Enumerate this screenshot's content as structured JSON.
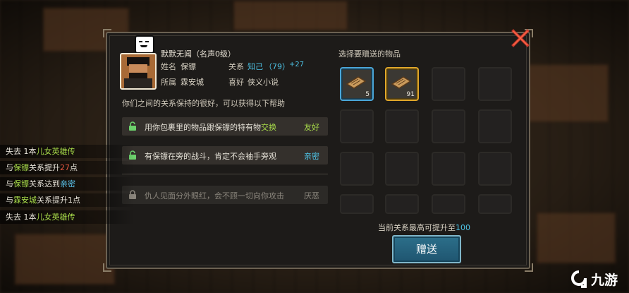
{
  "character": {
    "name": "默默无闻（名声0级）",
    "name_label": "姓名",
    "name_value": "保镖",
    "relation_label": "关系",
    "relation_value": "知己",
    "relation_score": "（79）",
    "relation_delta": "+27",
    "faction_label": "所属",
    "faction_value": "霖安城",
    "hobby_label": "喜好",
    "hobby_value": "侠义小说"
  },
  "relation_desc": "你们之间的关系保持的很好，可以获得以下帮助",
  "perks": [
    {
      "text_a": "用你包裹里的物品跟保镖的特有物",
      "text_b": "交换",
      "tag": "友好",
      "unlocked": true
    },
    {
      "text_a": "有保镖在旁的战斗，肯定不会袖手旁观",
      "text_b": "",
      "tag": "亲密",
      "unlocked": true
    },
    {
      "text_a": "仇人见面分外眼红，会不顾一切向你攻击",
      "text_b": "",
      "tag": "厌恶",
      "unlocked": false
    }
  ],
  "gift": {
    "title": "选择要赠送的物品",
    "items": [
      {
        "count": "5",
        "selected": "blue"
      },
      {
        "count": "91",
        "selected": "gold"
      }
    ],
    "max_prefix": "当前关系最高可提升至",
    "max_value": "100",
    "button_label": "赠送"
  },
  "log": [
    {
      "parts": [
        {
          "t": "失去 1本",
          "c": "white"
        },
        {
          "t": "儿女英雄传",
          "c": "green"
        }
      ]
    },
    {
      "parts": [
        {
          "t": "与",
          "c": "white"
        },
        {
          "t": "保镖",
          "c": "green"
        },
        {
          "t": "关系提升",
          "c": "white"
        },
        {
          "t": "27",
          "c": "red"
        },
        {
          "t": "点",
          "c": "white"
        }
      ]
    },
    {
      "parts": [
        {
          "t": "与",
          "c": "white"
        },
        {
          "t": "保镖",
          "c": "green"
        },
        {
          "t": "关系达到",
          "c": "white"
        },
        {
          "t": "亲密",
          "c": "blue2"
        }
      ]
    },
    {
      "parts": [
        {
          "t": "与",
          "c": "white"
        },
        {
          "t": "霖安城",
          "c": "green"
        },
        {
          "t": "关系提升1点",
          "c": "white"
        }
      ]
    },
    {
      "parts": [
        {
          "t": "失去 1本",
          "c": "white"
        },
        {
          "t": "儿女英雄传",
          "c": "green"
        }
      ]
    }
  ],
  "watermark": "九游",
  "colors": {
    "accent_cyan": "#4ec5e8",
    "accent_green": "#a8dc4a",
    "accent_red": "#e0563e",
    "button_blue": "#2c6f8a"
  }
}
